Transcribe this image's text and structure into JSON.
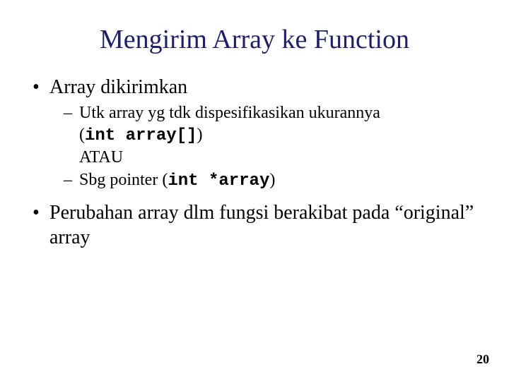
{
  "title": "Mengirim Array ke Function",
  "bullets": {
    "b1": "Array dikirimkan",
    "b1_sub1_text": "Utk array yg tdk dispesifikasikan ukurannya",
    "b1_sub1_code": "int array[]",
    "b1_sub1_line2": "ATAU",
    "b1_sub2_text": "Sbg pointer (",
    "b1_sub2_code": "int *array",
    "b1_sub2_close": ")",
    "b2": "Perubahan array dlm fungsi berakibat pada “original” array"
  },
  "page_number": "20"
}
